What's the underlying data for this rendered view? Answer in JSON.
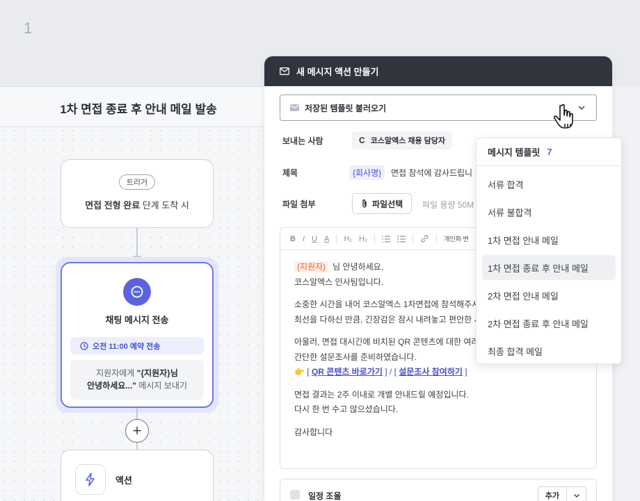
{
  "step_number": "1",
  "canvas": {
    "title": "1차 면접 종료 후 안내 메일 발송",
    "trigger": {
      "pill": "트리거",
      "text_bold": "면접 전형 완료",
      "text_rest": " 단계 도착 시"
    },
    "chat_node": {
      "title": "채팅 메시지 전송",
      "schedule": "오전 11:00 예약 전송",
      "msg_prefix": "지원자에게 ",
      "msg_bold_1": "\"{지원자}님",
      "msg_bold_2": "안녕하세요...\"",
      "msg_suffix": " 메시지 보내기"
    },
    "plus": "+",
    "action_node": {
      "label": "액션"
    }
  },
  "panel": {
    "title": "새 메시지 액션 만들기",
    "template_select": "저장된 템플릿 불러오기",
    "sender_label": "보내는 사람",
    "sender_badge": "C",
    "sender_name": "코스알엑스 채용 담당자",
    "subject_label": "제목",
    "subject_var": "{회사명}",
    "subject_text": "면접 참석에 감사드립니",
    "file_label": "파일 첨부",
    "file_button": "파일선택",
    "file_hint": "파일 용량 50M",
    "toolbar": {
      "b": "B",
      "i": "I",
      "u": "U",
      "a": "A",
      "h1": "H₁",
      "h2": "H₂",
      "personal": "개인화 변"
    },
    "body": {
      "line1_var": "{지원자}",
      "line1": "님 안녕하세요,",
      "line2": "코스알엑스 인사팀입니다.",
      "line3": "소중한 시간을 내어 코스알엑스 1차면접에 참석해주시",
      "line4": "최선을 다하신 만큼, 긴장감은 잠시 내려놓고 편안한 시",
      "line5": "아울러, 면접 대시긴에 비치된 QR 콘텐츠에 대한 여러",
      "line6": "간단한 설문조사를 준비하였습니다.",
      "link_prefix": "👉 ",
      "link1": "QR 콘텐츠 바로가기",
      "link_sep": " ] / [ ",
      "link2": "설문조사 참여하기",
      "line7": "면접 결과는 2주 이내로 개별 안내드릴 예정입니다.",
      "line8": "다시 한 번 수고 많으셨습니다.",
      "line9": "감사합니다"
    },
    "schedule_label": "일정 조율",
    "add_button": "추가"
  },
  "dropdown": {
    "title": "메시지 템플릿",
    "count": "7",
    "items": [
      "서류 합격",
      "서류 불합격",
      "1차 면접 안내 메일",
      "1차 면접 종료 후 안내 메일",
      "2차 면접 안내 메일",
      "2차 면접 종료 후 안내 메일",
      "최종 합격 메일"
    ],
    "active_index": 3
  },
  "colors": {
    "accent": "#5b63e0",
    "panel_header": "#30353d",
    "var_orange": "#e6662c"
  }
}
